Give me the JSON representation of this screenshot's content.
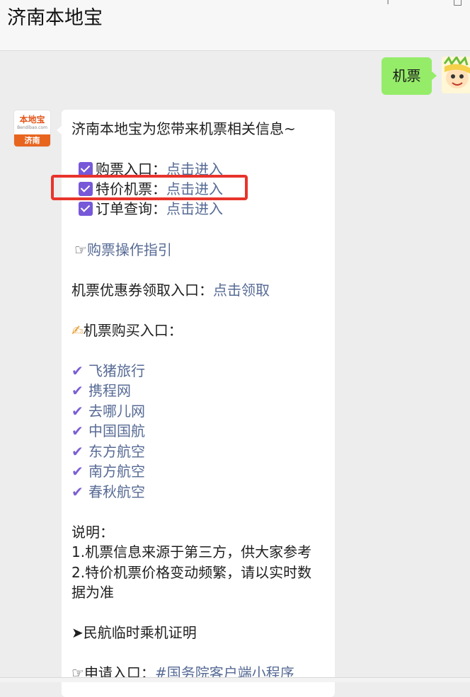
{
  "header": {
    "title": "济南本地宝"
  },
  "user_message": {
    "text": "机票"
  },
  "bot_avatar": {
    "brand": "本地宝",
    "site": "Bendibao.com",
    "city": "济南"
  },
  "bot_message": {
    "intro": "济南本地宝为您带来机票相关信息~",
    "menu": [
      {
        "label": "购票入口：",
        "link": "点击进入"
      },
      {
        "label": "特价机票：",
        "link": "点击进入"
      },
      {
        "label": "订单查询：",
        "link": "点击进入"
      }
    ],
    "guide_icon": "☞",
    "guide_link": "购票操作指引",
    "coupon_label": "机票优惠券领取入口：",
    "coupon_link": "点击领取",
    "purchase_icon": "✍",
    "purchase_title": "机票购买入口：",
    "tick_icon": "✔",
    "providers": [
      "飞猪旅行",
      "携程网",
      "去哪儿网",
      "中国国航",
      "东方航空",
      "南方航空",
      "春秋航空"
    ],
    "note_title": "说明：",
    "note_1": "1.机票信息来源于第三方，供大家参考",
    "note_2a": "2.特价机票价格变动频繁，请以实时数",
    "note_2b": "据为准",
    "arrow_icon": "➤",
    "civil_aviation": "民航临时乘机证明",
    "apply_icon": "☞",
    "apply_label": "申请入口：",
    "apply_link": "#国务院客户端小程序"
  },
  "colors": {
    "bubble_green": "#95ec69",
    "link": "#576b95",
    "highlight": "#e8342b",
    "checkbox": "#7758d8"
  }
}
